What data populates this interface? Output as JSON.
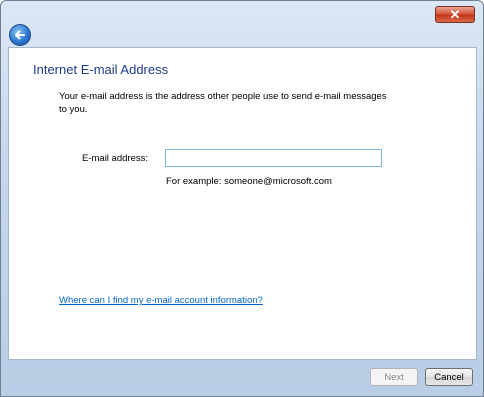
{
  "window": {
    "close_glyph": "✕",
    "back_glyph": "←"
  },
  "page": {
    "title": "Internet E-mail Address",
    "description": "Your e-mail address is the address other people use to send e-mail messages to you."
  },
  "form": {
    "email_label": "E-mail address:",
    "email_value": "",
    "example": "For example: someone@microsoft.com"
  },
  "help_link": "Where can I find my e-mail account information?",
  "footer": {
    "next_label": "Next",
    "cancel_label": "Cancel"
  },
  "colors": {
    "title": "#1e3c87",
    "link": "#0066cc",
    "frame": "#c7d8ec"
  }
}
